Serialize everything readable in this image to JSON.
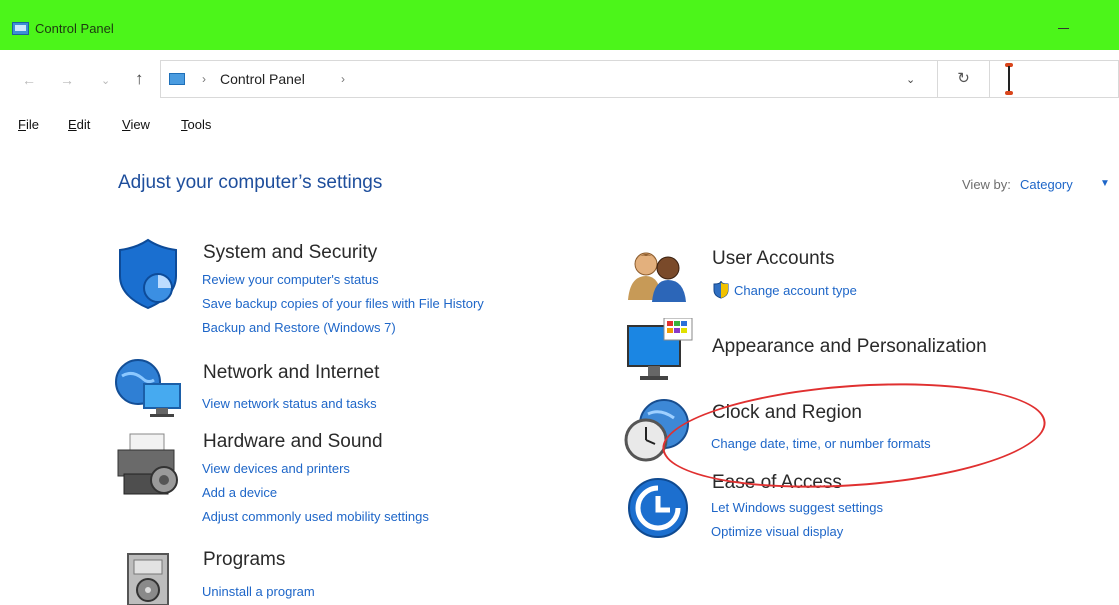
{
  "window": {
    "title": "Control Panel"
  },
  "address": {
    "breadcrumb": "Control Panel",
    "separator": "›"
  },
  "nav": {
    "back": "←",
    "forward": "→",
    "recent": "⌄",
    "up": "↑",
    "dropdown": "⌄",
    "refresh": "↻"
  },
  "menu": {
    "file": "File",
    "file_u": "F",
    "file_rest": "ile",
    "edit": "Edit",
    "edit_u": "E",
    "edit_rest": "dit",
    "view": "View",
    "view_u": "V",
    "view_rest": "iew",
    "tools": "Tools",
    "tools_u": "T",
    "tools_rest": "ools"
  },
  "main": {
    "heading": "Adjust your computer’s settings",
    "view_by_label": "View by:",
    "view_by_value": "Category",
    "view_by_arrow": "▼"
  },
  "categories": {
    "system_security": {
      "title": "System and Security",
      "links": [
        "Review your computer's status",
        "Save backup copies of your files with File History",
        "Backup and Restore (Windows 7)"
      ]
    },
    "network": {
      "title": "Network and Internet",
      "links": [
        "View network status and tasks"
      ]
    },
    "hardware": {
      "title": "Hardware and Sound",
      "links": [
        "View devices and printers",
        "Add a device",
        "Adjust commonly used mobility settings"
      ]
    },
    "programs": {
      "title": "Programs",
      "links": [
        "Uninstall a program"
      ]
    },
    "user_accounts": {
      "title": "User Accounts",
      "links": [
        "Change account type"
      ]
    },
    "appearance": {
      "title": "Appearance and Personalization",
      "links": []
    },
    "clock": {
      "title": "Clock and Region",
      "links": [
        "Change date, time, or number formats"
      ]
    },
    "ease": {
      "title": "Ease of Access",
      "links": [
        "Let Windows suggest settings",
        "Optimize visual display"
      ]
    }
  },
  "colors": {
    "titlebar": "#4cf51a",
    "link": "#1e66c8",
    "heading": "#1e4e9c",
    "annotation": "#e03030"
  }
}
